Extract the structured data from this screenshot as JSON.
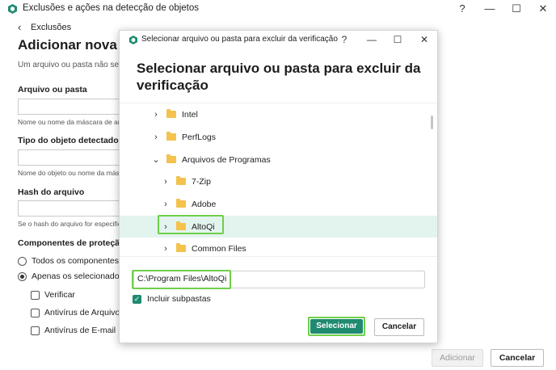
{
  "window": {
    "title": "Exclusões e ações na detecção de objetos",
    "help": "?",
    "minimize": "—",
    "maximize": "☐",
    "close": "✕"
  },
  "back": {
    "arrow": "‹",
    "label": "Exclusões"
  },
  "form": {
    "heading": "Adicionar nova e",
    "description": "Um arquivo ou pasta não será",
    "file_label": "Arquivo ou pasta",
    "file_hint": "Nome ou nome da máscara de arc",
    "type_label": "Tipo do objeto detectado",
    "type_hint": "Nome do objeto ou nome da másc",
    "hash_label": "Hash do arquivo",
    "hash_hint": "Se o hash do arquivo for especific",
    "components_label": "Componentes de proteção",
    "radio_all": "Todos os componentes",
    "radio_selected": "Apenas os selecionados",
    "check_verify": "Verificar",
    "check_antivirus_files": "Antivírus de Arquivos",
    "check_antivirus_email": "Antivírus de E-mail",
    "add_button": "Adicionar",
    "cancel_button": "Cancelar"
  },
  "dialog": {
    "title": "Selecionar arquivo ou pasta para excluir da verificação",
    "help": "?",
    "minimize": "—",
    "maximize": "☐",
    "close": "✕",
    "heading": "Selecionar arquivo ou pasta para excluir da verificação",
    "tree": [
      {
        "label": "Intel",
        "chevron": "›",
        "level": 0,
        "expanded": false,
        "selected": false
      },
      {
        "label": "PerfLogs",
        "chevron": "›",
        "level": 0,
        "expanded": false,
        "selected": false
      },
      {
        "label": "Arquivos de Programas",
        "chevron": "⌄",
        "level": 0,
        "expanded": true,
        "selected": false
      },
      {
        "label": "7-Zip",
        "chevron": "›",
        "level": 1,
        "expanded": false,
        "selected": false
      },
      {
        "label": "Adobe",
        "chevron": "›",
        "level": 1,
        "expanded": false,
        "selected": false
      },
      {
        "label": "AltoQi",
        "chevron": "›",
        "level": 1,
        "expanded": false,
        "selected": true
      },
      {
        "label": "Common Files",
        "chevron": "›",
        "level": 1,
        "expanded": false,
        "selected": false
      }
    ],
    "path_value": "C:\\Program Files\\AltoQi",
    "include_subfolders": "Incluir subpastas",
    "select_button": "Selecionar",
    "cancel_button": "Cancelar"
  },
  "colors": {
    "accent": "#1f8a70",
    "selection": "#e3f4ef",
    "highlight": "#6fcf4a",
    "folder": "#f4c24d"
  }
}
